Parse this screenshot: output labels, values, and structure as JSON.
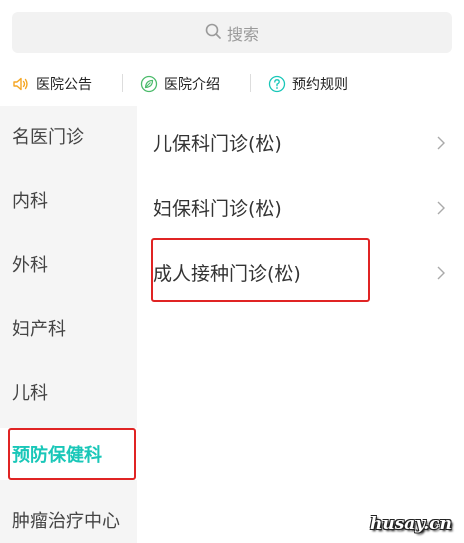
{
  "search": {
    "placeholder": "搜索",
    "icon": "search-icon"
  },
  "quicklinks": [
    {
      "label": "医院公告",
      "icon": "speaker-icon",
      "color": "#f5a623"
    },
    {
      "label": "医院介绍",
      "icon": "leaf-icon",
      "color": "#4cbb6b"
    },
    {
      "label": "预约规则",
      "icon": "question-icon",
      "color": "#19c7b8"
    }
  ],
  "sidebar": {
    "items": [
      {
        "label": "名医门诊"
      },
      {
        "label": "内科"
      },
      {
        "label": "外科"
      },
      {
        "label": "妇产科"
      },
      {
        "label": "儿科"
      },
      {
        "label": "预防保健科"
      },
      {
        "label": "肿瘤治疗中心"
      }
    ],
    "active_index": 5,
    "active_color": "#19c7b8"
  },
  "clinics": [
    {
      "label": "儿保科门诊(松)"
    },
    {
      "label": "妇保科门诊(松)"
    },
    {
      "label": "成人接种门诊(松)"
    }
  ],
  "highlight_color": "#e02424",
  "watermark": "husay.cn"
}
